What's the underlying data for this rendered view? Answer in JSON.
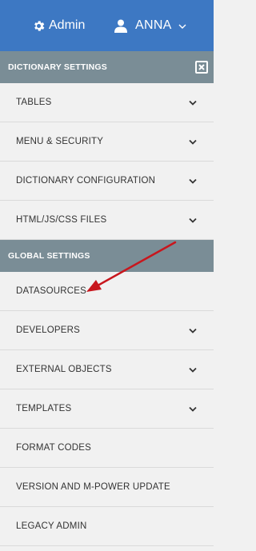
{
  "header": {
    "admin_label": "Admin",
    "user_label": "ANNA",
    "background": "#3d78c3"
  },
  "sections": {
    "dictionary": {
      "label": "DICTIONARY SETTINGS"
    },
    "global": {
      "label": "GLOBAL SETTINGS"
    }
  },
  "items": {
    "tables": "TABLES",
    "menu_security": "MENU & SECURITY",
    "dictionary_configuration": "DICTIONARY CONFIGURATION",
    "html_js_css": "HTML/JS/CSS FILES",
    "datasources": "DATASOURCES",
    "developers": "DEVELOPERS",
    "external_objects": "EXTERNAL OBJECTS",
    "templates": "TEMPLATES",
    "format_codes": "FORMAT CODES",
    "version_update": "VERSION AND M-POWER UPDATE",
    "legacy_admin": "LEGACY ADMIN"
  },
  "icons": {
    "admin": "gear-icon",
    "user": "user-icon",
    "user_menu": "chevron-down-icon",
    "close": "close-icon",
    "expand": "chevron-down-icon",
    "annotation": "red-arrow-annotation"
  },
  "colors": {
    "section_header": "#7a8d96",
    "menu_background": "#f1f1f1",
    "annotation_arrow": "#c8161d"
  }
}
